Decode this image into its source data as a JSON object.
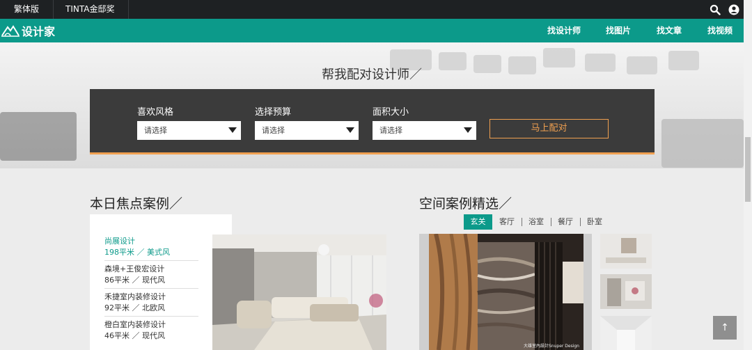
{
  "topbar": {
    "links": [
      "繁体版",
      "TINTA金邸奖"
    ],
    "icons": [
      "search-icon",
      "user-icon"
    ]
  },
  "nav": {
    "logo_text": "设计家",
    "links": [
      "找设计师",
      "找图片",
      "找文章",
      "找视频"
    ]
  },
  "hero": {
    "title": "帮我配对设计师／",
    "fields": [
      {
        "label": "喜欢风格",
        "placeholder": "请选择"
      },
      {
        "label": "选择预算",
        "placeholder": "请选择"
      },
      {
        "label": "面积大小",
        "placeholder": "请选择"
      }
    ],
    "button": "马上配对",
    "accent": "#f0a050"
  },
  "daily": {
    "title": "本日焦点案例／",
    "items": [
      {
        "name": "尚展设计",
        "meta": "198平米 ／ 美式风"
      },
      {
        "name": "森境+王俊宏设计",
        "meta": "86平米 ／ 现代风"
      },
      {
        "name": "禾捷室内装修设计",
        "meta": "92平米 ／ 北欧风"
      },
      {
        "name": "橙白室内装修设计",
        "meta": "46平米 ／ 现代风"
      }
    ]
  },
  "space": {
    "title": "空间案例精选／",
    "tabs": [
      "玄关",
      "客厅",
      "浴室",
      "餐厅",
      "卧室"
    ],
    "active_tab": "玄关",
    "main_caption": "大雄室內設計Snuper Design"
  },
  "colors": {
    "brand": "#0c9a8a",
    "dark": "#1e2123"
  },
  "back_to_top": "↑"
}
